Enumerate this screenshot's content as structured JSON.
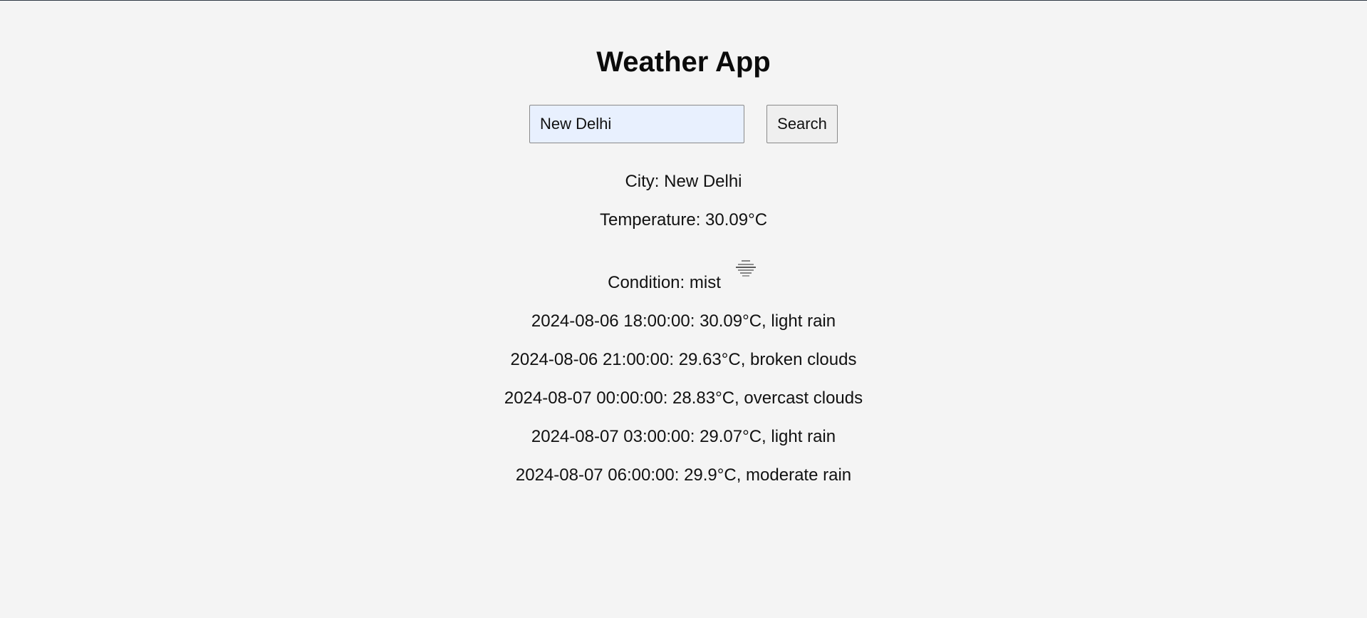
{
  "app": {
    "title": "Weather App"
  },
  "search": {
    "value": "New Delhi",
    "button_label": "Search"
  },
  "current": {
    "city_line": "City: New Delhi",
    "temperature_line": "Temperature: 30.09°C",
    "condition_line": "Condition: mist",
    "condition_icon": "mist-icon"
  },
  "forecast": [
    "2024-08-06 18:00:00: 30.09°C, light rain",
    "2024-08-06 21:00:00: 29.63°C, broken clouds",
    "2024-08-07 00:00:00: 28.83°C, overcast clouds",
    "2024-08-07 03:00:00: 29.07°C, light rain",
    "2024-08-07 06:00:00: 29.9°C, moderate rain"
  ],
  "colors": {
    "page_background": "#f4f4f4",
    "input_background": "#e8f0fe",
    "button_background": "#efefef",
    "top_border": "#2f3a45"
  }
}
